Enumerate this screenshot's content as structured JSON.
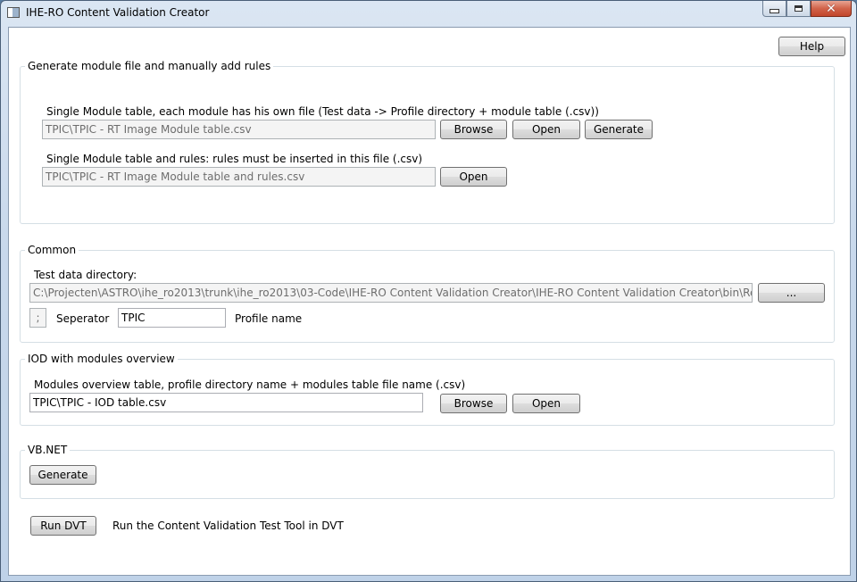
{
  "window": {
    "title": "IHE-RO Content Validation Creator"
  },
  "help_label": "Help",
  "generate_group": {
    "title": "Generate module file and manually add rules",
    "single_module_desc": "Single Module table, each module has his own file (Test data -> Profile directory + module table (.csv))",
    "single_module_value": "TPIC\\TPIC - RT Image Module table.csv",
    "browse_label": "Browse",
    "open_label": "Open",
    "generate_label": "Generate",
    "rules_desc": "Single Module table and rules: rules must be inserted in this file (.csv)",
    "rules_value": "TPIC\\TPIC - RT Image Module table and rules.csv",
    "rules_open_label": "Open"
  },
  "common_group": {
    "title": "Common",
    "test_data_label": "Test data directory:",
    "test_data_value": "C:\\Projecten\\ASTRO\\ihe_ro2013\\trunk\\ihe_ro2013\\03-Code\\IHE-RO Content Validation Creator\\IHE-RO Content Validation Creator\\bin\\Release\\Test data",
    "browse_dots_label": "...",
    "separator_value": ";",
    "separator_label": "Seperator",
    "profile_value": "TPIC",
    "profile_label": "Profile name"
  },
  "iod_group": {
    "title": "IOD with modules overview",
    "desc": "Modules overview table, profile directory name + modules table file name (.csv)",
    "value": "TPIC\\TPIC - IOD table.csv",
    "browse_label": "Browse",
    "open_label": "Open"
  },
  "vbnet_group": {
    "title": "VB.NET",
    "generate_label": "Generate"
  },
  "run": {
    "button_label": "Run DVT",
    "description": "Run the Content Validation Test Tool in DVT"
  }
}
